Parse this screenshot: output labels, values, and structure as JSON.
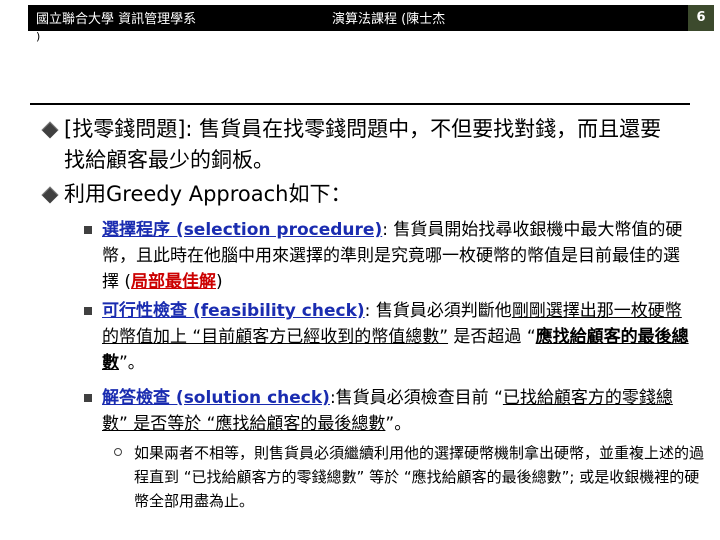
{
  "header": {
    "left": "國立聯合大學 資訊管理學系",
    "left_paren": ")",
    "center": "演算法課程 (陳士杰",
    "page_number": "6"
  },
  "bullets": [
    {
      "text": "[找零錢問題]: 售貨員在找零錢問題中，不但要找對錢，而且還要找給顧客最少的銅板。"
    },
    {
      "text": "利用Greedy Approach如下："
    }
  ],
  "sub": {
    "selection": {
      "term": "選擇程序 (selection procedure)",
      "colon": ": ",
      "body": "售貨員開始找尋收銀機中最大幣值的硬幣，且此時在他腦中用來選擇的準則是究竟哪一枚硬幣的幣值是目前最佳的選擇 (",
      "highlight": "局部最佳解",
      "end": ")"
    },
    "feasibility": {
      "term": "可行性檢查 (feasibility check)",
      "colon": ": ",
      "body1": "售貨員必須判斷他",
      "underlined": "剛剛選擇出那一枚硬幣的幣值加上 “目前顧客方已經收到的幣值總數”",
      "body2": " 是否超過 “",
      "bold_underlined": "應找給顧客的最後總數",
      "end": "”。"
    },
    "solution": {
      "term": "解答檢查 (solution check)",
      "colon": ":",
      "body1": "售貨員必須檢查目前 “",
      "underlined": "已找給顧客方的零錢總數” 是否等於 “應找給顧客的最後總數",
      "end": "”。"
    }
  },
  "subsub": {
    "text": "如果兩者不相等，則售貨員必須繼續利用他的選擇硬幣機制拿出硬幣，並重複上述的過程直到 “已找給顧客方的零錢總數” 等於 “應找給顧客的最後總數”; 或是收銀機裡的硬幣全部用盡為止。"
  }
}
